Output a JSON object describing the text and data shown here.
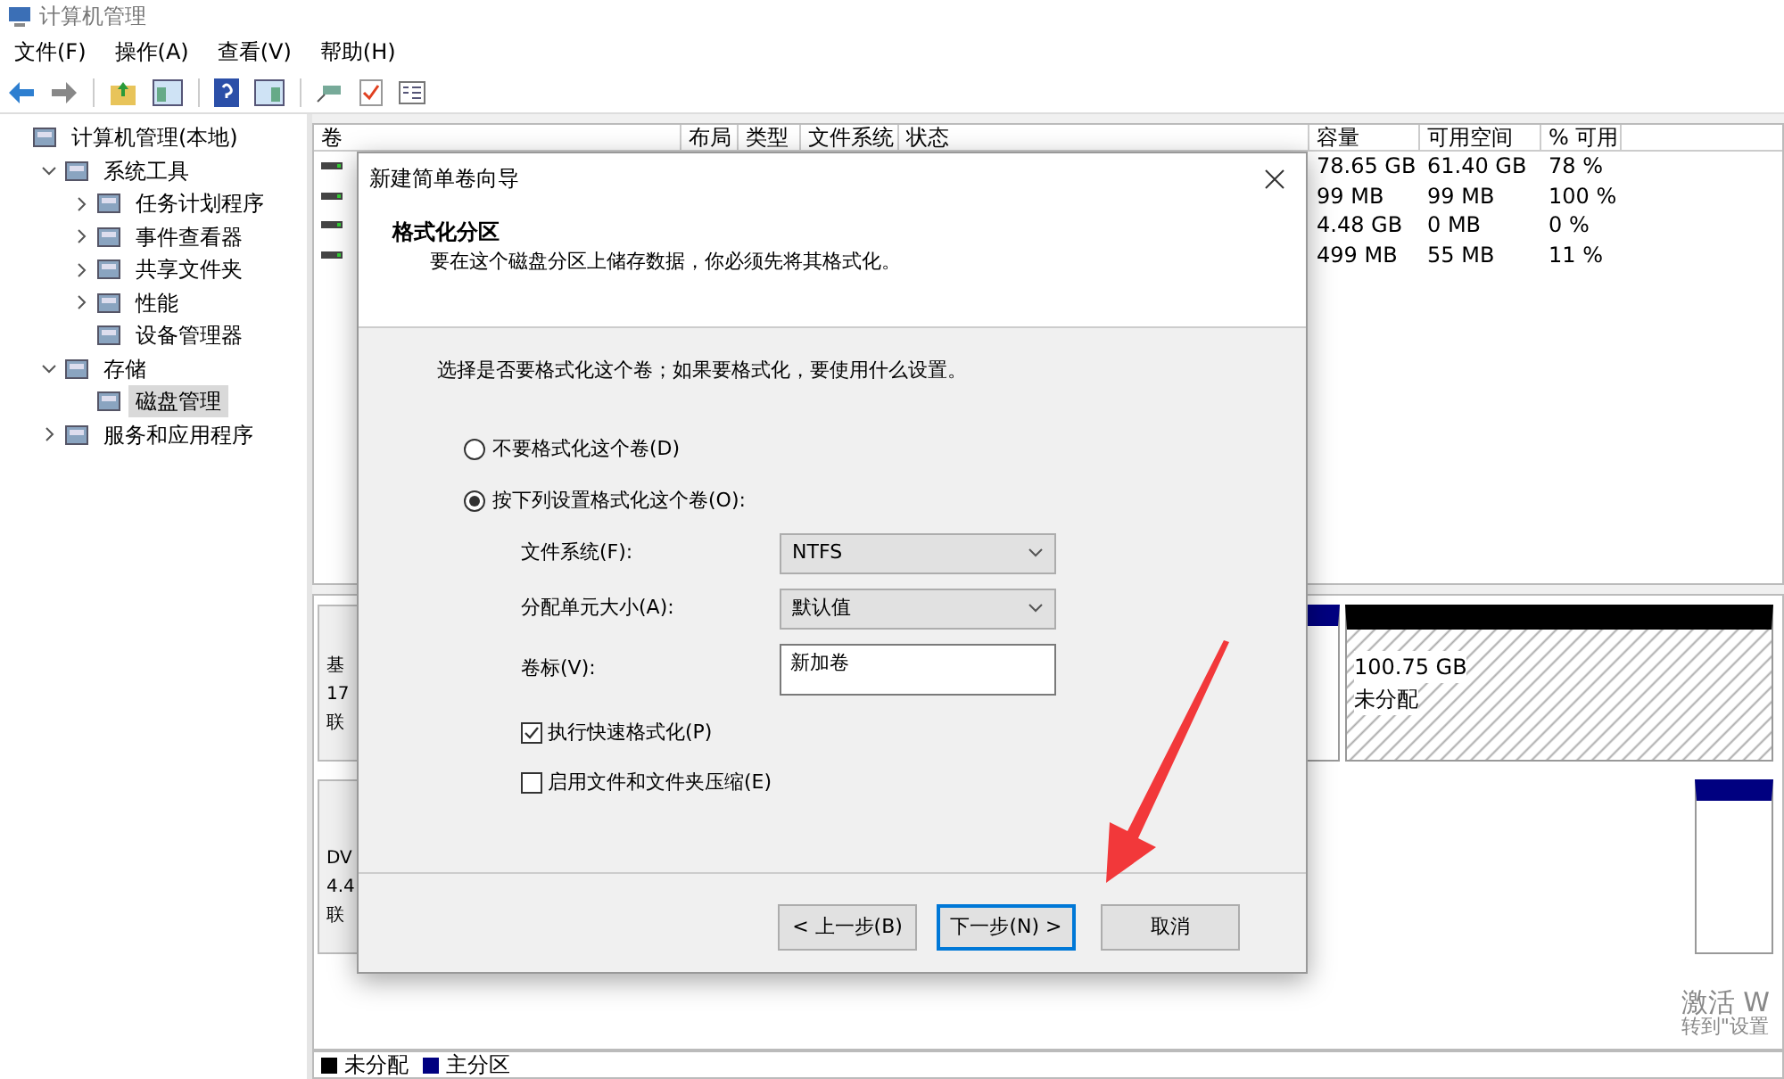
{
  "window": {
    "title": "计算机管理"
  },
  "menu": [
    "文件(F)",
    "操作(A)",
    "查看(V)",
    "帮助(H)"
  ],
  "tree": [
    {
      "label": "计算机管理(本地)",
      "selected": false,
      "children": [
        {
          "label": "系统工具",
          "expanded": true,
          "selected": false,
          "children": [
            {
              "label": "任务计划程序",
              "expanded": false,
              "selected": false
            },
            {
              "label": "事件查看器",
              "expanded": false,
              "selected": false
            },
            {
              "label": "共享文件夹",
              "expanded": false,
              "selected": false
            },
            {
              "label": "性能",
              "expanded": false,
              "selected": false
            },
            {
              "label": "设备管理器",
              "selected": false
            }
          ]
        },
        {
          "label": "存储",
          "expanded": true,
          "selected": false,
          "children": [
            {
              "label": "磁盘管理",
              "selected": true
            }
          ]
        },
        {
          "label": "服务和应用程序",
          "expanded": false,
          "selected": false
        }
      ]
    }
  ],
  "volume_table": {
    "columns": [
      "卷",
      "布局",
      "类型",
      "文件系统",
      "状态",
      "容量",
      "可用空间",
      "% 可用"
    ],
    "rows": [
      [
        "78.65 GB",
        "61.40 GB",
        "78 %"
      ],
      [
        "99 MB",
        "99 MB",
        "100 %"
      ],
      [
        "4.48 GB",
        "0 MB",
        "0 %"
      ],
      [
        "499 MB",
        "55 MB",
        "11 %"
      ]
    ]
  },
  "disks": [
    {
      "label_lines": [
        "基",
        "17",
        "联"
      ],
      "unallocated": {
        "size": "100.75 GB",
        "label": "未分配"
      }
    },
    {
      "label_lines": [
        "DV",
        "4.4",
        "联"
      ]
    }
  ],
  "legend": [
    {
      "label": "未分配",
      "color": "#000000"
    },
    {
      "label": "主分区",
      "color": "#000080"
    }
  ],
  "activation": [
    "激活 W",
    "转到\"设置"
  ],
  "dialog": {
    "title": "新建简单卷向导",
    "heading": "格式化分区",
    "subheading": "要在这个磁盘分区上储存数据，你必须先将其格式化。",
    "prompt": "选择是否要格式化这个卷；如果要格式化，要使用什么设置。",
    "radios": [
      {
        "label": "不要格式化这个卷(D)",
        "selected": false
      },
      {
        "label": "按下列设置格式化这个卷(O):",
        "selected": true
      }
    ],
    "fields": [
      {
        "kind": "dropdown",
        "label": "文件系统(F):",
        "value": "NTFS"
      },
      {
        "kind": "dropdown",
        "label": "分配单元大小(A):",
        "value": "默认值"
      },
      {
        "kind": "text",
        "label": "卷标(V):",
        "value": "新加卷"
      }
    ],
    "checkboxes": [
      {
        "label": "执行快速格式化(P)",
        "checked": true
      },
      {
        "label": "启用文件和文件夹压缩(E)",
        "checked": false
      }
    ],
    "buttons": [
      {
        "label": "< 上一步(B)",
        "default": false
      },
      {
        "label": "下一步(N) >",
        "default": true
      },
      {
        "label": "取消",
        "default": false
      }
    ]
  }
}
